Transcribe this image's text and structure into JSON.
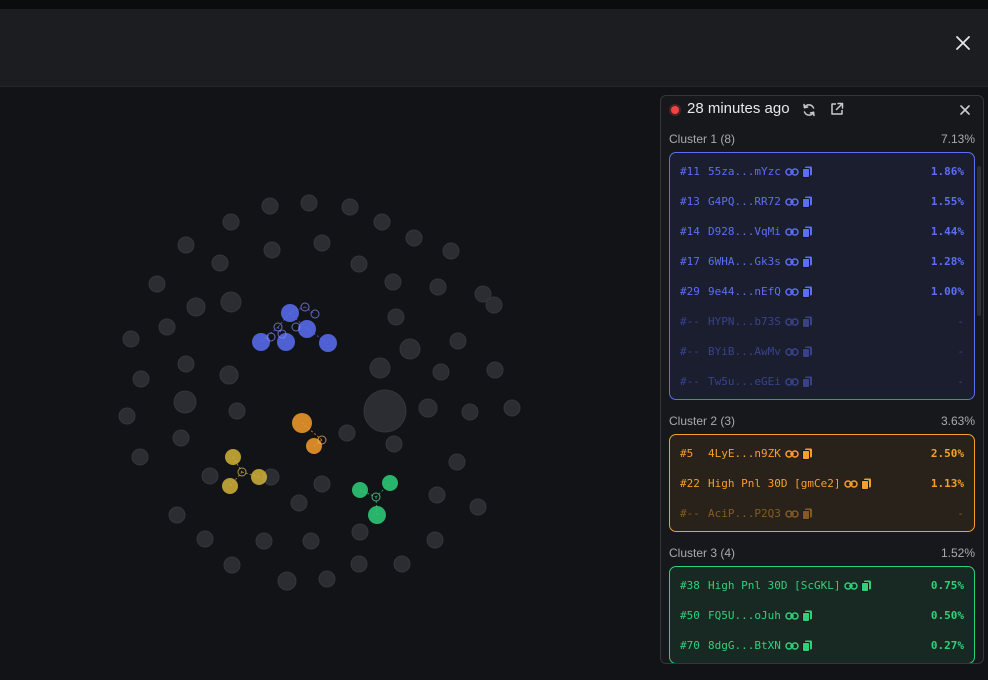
{
  "panel": {
    "time_ago": "28 minutes ago"
  },
  "colors": {
    "cluster1": "#5b6ef5",
    "cluster2": "#f59e2b",
    "cluster3": "#2fd07a",
    "cluster_yellow": "#d4b43a",
    "neutral": "#2b2d33",
    "live": "#ef4444"
  },
  "icons": {
    "close": "close-icon",
    "refresh": "refresh-icon",
    "external": "external-link-icon",
    "link": "link-icon",
    "copy": "copy-icon",
    "live": "live-dot-icon"
  },
  "clusters": [
    {
      "title": "Cluster 1 (8)",
      "percent": "7.13%",
      "rows": [
        {
          "rank": "#11",
          "addr": "55za...mYzc",
          "pct": "1.86%",
          "dim": false
        },
        {
          "rank": "#13",
          "addr": "G4PQ...RR72",
          "pct": "1.55%",
          "dim": false
        },
        {
          "rank": "#14",
          "addr": "D928...VqMi",
          "pct": "1.44%",
          "dim": false
        },
        {
          "rank": "#17",
          "addr": "6WHA...Gk3s",
          "pct": "1.28%",
          "dim": false
        },
        {
          "rank": "#29",
          "addr": "9e44...nEfQ",
          "pct": "1.00%",
          "dim": false
        },
        {
          "rank": "#--",
          "addr": "HYPN...b73S",
          "pct": "-",
          "dim": true
        },
        {
          "rank": "#--",
          "addr": "BYiB...AwMv",
          "pct": "-",
          "dim": true
        },
        {
          "rank": "#--",
          "addr": "Tw5u...eGEi",
          "pct": "-",
          "dim": true
        }
      ]
    },
    {
      "title": "Cluster 2 (3)",
      "percent": "3.63%",
      "rows": [
        {
          "rank": "#5",
          "addr": "4LyE...n9ZK",
          "pct": "2.50%",
          "dim": false
        },
        {
          "rank": "#22",
          "addr": "High Pnl 30D [gmCe2]",
          "pct": "1.13%",
          "dim": false
        },
        {
          "rank": "#--",
          "addr": "AciP...P2Q3",
          "pct": "-",
          "dim": true
        }
      ]
    },
    {
      "title": "Cluster 3 (4)",
      "percent": "1.52%",
      "rows": [
        {
          "rank": "#38",
          "addr": "High Pnl 30D [ScGKL]",
          "pct": "0.75%",
          "dim": false
        },
        {
          "rank": "#50",
          "addr": "FQ5U...oJuh",
          "pct": "0.50%",
          "dim": false
        },
        {
          "rank": "#70",
          "addr": "8dgG...BtXN",
          "pct": "0.27%",
          "dim": false
        }
      ]
    }
  ]
}
